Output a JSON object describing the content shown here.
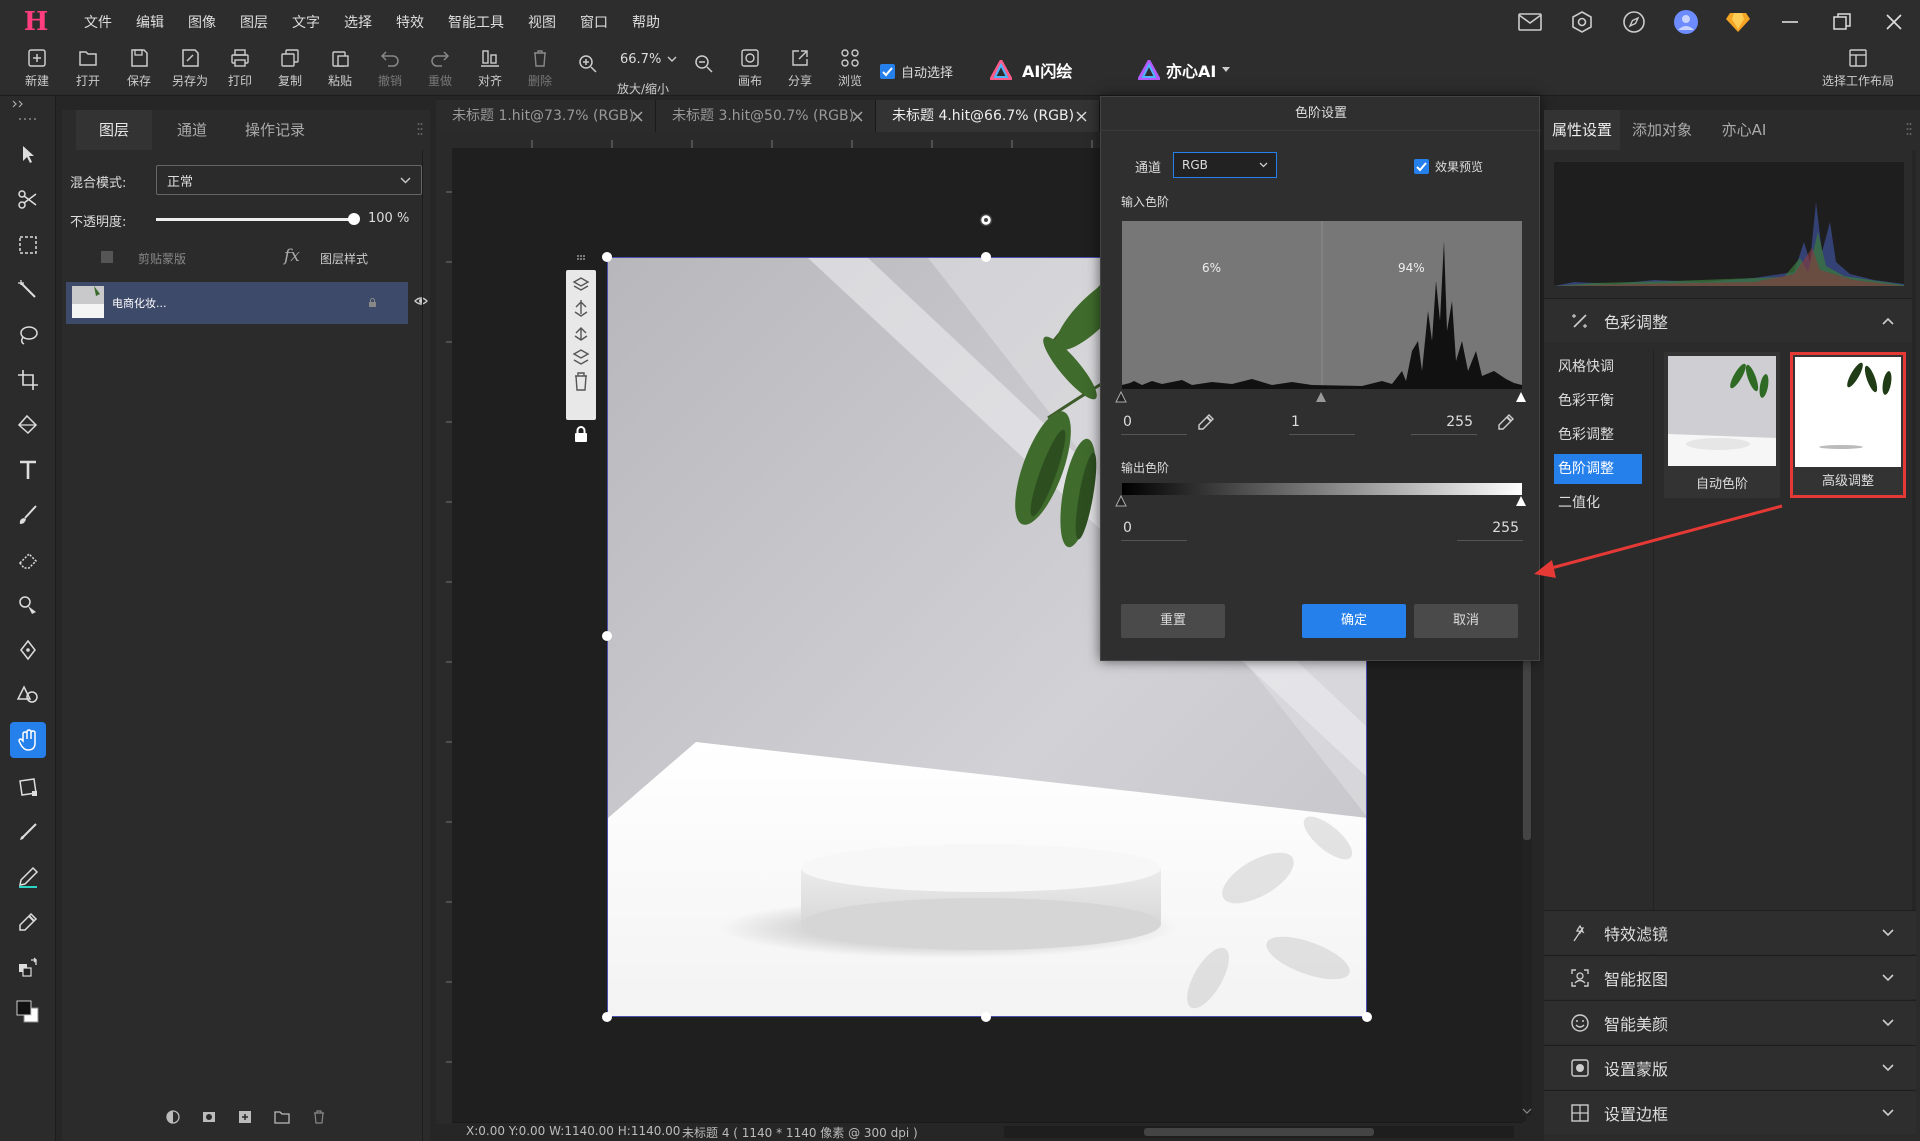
{
  "app": {
    "logo": "H"
  },
  "menubar": {
    "items": [
      "文件",
      "编辑",
      "图像",
      "图层",
      "文字",
      "选择",
      "特效",
      "智能工具",
      "视图",
      "窗口",
      "帮助"
    ]
  },
  "toolbar": {
    "new": "新建",
    "open": "打开",
    "save": "保存",
    "saveas": "另存为",
    "print": "打印",
    "copy": "复制",
    "paste": "粘贴",
    "undo": "撤销",
    "redo": "重做",
    "align": "对齐",
    "delete": "删除",
    "zoom_value": "66.7%",
    "zoom_label": "放大/缩小",
    "canvas": "画布",
    "share": "分享",
    "browse": "浏览",
    "auto_select": "自动选择",
    "ai_flash": "AI闪绘",
    "yixin_ai": "亦心AI",
    "workspace": "选择工作布局"
  },
  "layers_panel": {
    "tabs": [
      "图层",
      "通道",
      "操作记录"
    ],
    "blend_label": "混合模式:",
    "blend_value": "正常",
    "opacity_label": "不透明度:",
    "opacity_value": "100",
    "opacity_unit": "%",
    "opacity_level": 1.0,
    "clip_mask": "剪贴蒙版",
    "fx": "fx",
    "layer_style": "图层样式",
    "layer_name": "电商化妆..."
  },
  "documents": {
    "tabs": [
      "未标题 1.hit@73.7% (RGB)",
      "未标题 3.hit@50.7% (RGB)",
      "未标题 4.hit@66.7% (RGB)"
    ],
    "active_index": 2
  },
  "status_bar": {
    "coords": "X:0.00 Y:0.00 W:1140.00 H:1140.00",
    "doc_info": "未标题 4 ( 1140 * 1140 像素 @ 300 dpi )"
  },
  "levels_dialog": {
    "title": "色阶设置",
    "channel_label": "通道",
    "channel_value": "RGB",
    "preview_label": "效果预览",
    "preview_checked": true,
    "input_label": "输入色阶",
    "left_pct": "6%",
    "right_pct": "94%",
    "input_black": "0",
    "input_gamma": "1",
    "input_white": "255",
    "output_label": "输出色阶",
    "output_black": "0",
    "output_white": "255",
    "reset": "重置",
    "ok": "确定",
    "cancel": "取消"
  },
  "right_panel": {
    "tabs": [
      "属性设置",
      "添加对象",
      "亦心AI"
    ],
    "color_section": "色彩调整",
    "sub_items": [
      "风格快调",
      "色彩平衡",
      "色彩调整",
      "色阶调整",
      "二值化"
    ],
    "active_sub": 3,
    "thumb_auto": "自动色阶",
    "thumb_advanced": "高级调整",
    "sections": [
      "特效滤镜",
      "智能抠图",
      "智能美颜",
      "设置蒙版",
      "设置边框"
    ]
  },
  "colors": {
    "accent": "#2680eb",
    "highlight_red": "#e53935",
    "logo": "#ff3d7f"
  }
}
